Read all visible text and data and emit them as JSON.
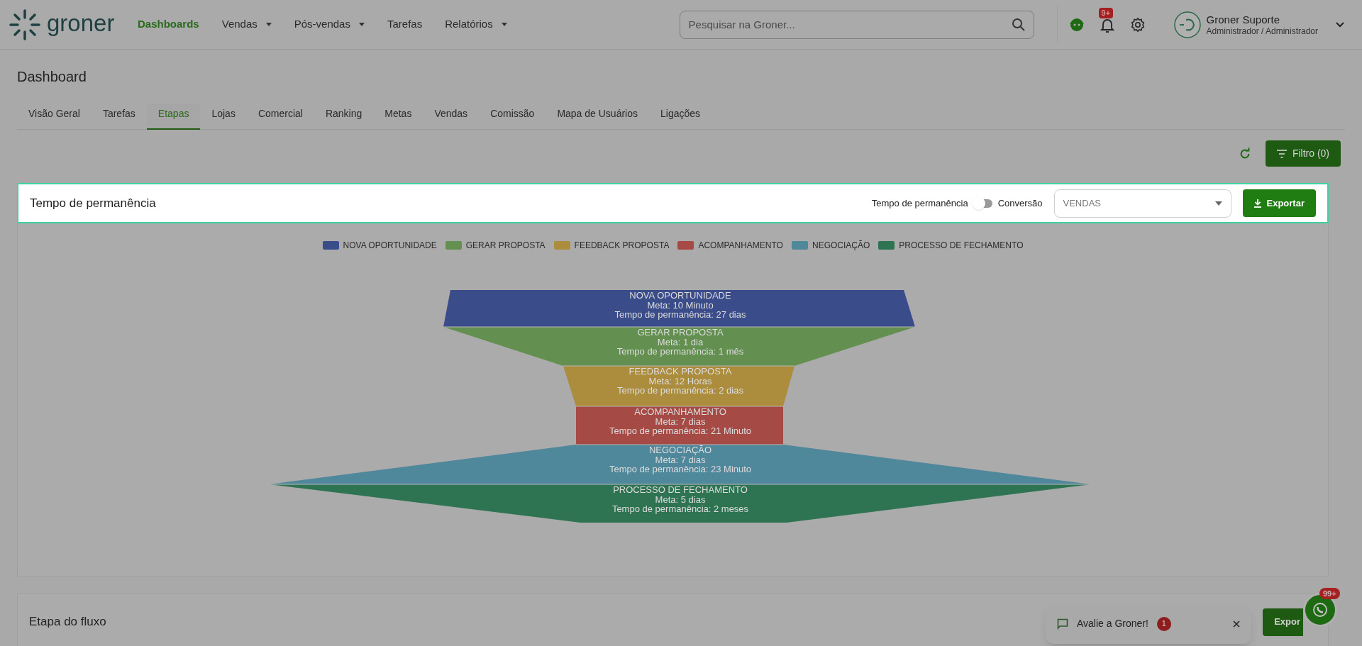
{
  "header": {
    "logo": "groner",
    "nav": [
      {
        "label": "Dashboards",
        "selected": true,
        "dropdown": false
      },
      {
        "label": "Vendas",
        "selected": false,
        "dropdown": true
      },
      {
        "label": "Pós-vendas",
        "selected": false,
        "dropdown": true
      },
      {
        "label": "Tarefas",
        "selected": false,
        "dropdown": false
      },
      {
        "label": "Relatórios",
        "selected": false,
        "dropdown": true
      }
    ],
    "search": {
      "placeholder": "Pesquisar na Groner..."
    },
    "notifications_badge": "9+",
    "user": {
      "name": "Groner Suporte",
      "role": "Administrador / Administrador"
    }
  },
  "page": {
    "title": "Dashboard",
    "tabs": [
      {
        "label": "Visão Geral",
        "selected": false
      },
      {
        "label": "Tarefas",
        "selected": false
      },
      {
        "label": "Etapas",
        "selected": true
      },
      {
        "label": "Lojas",
        "selected": false
      },
      {
        "label": "Comercial",
        "selected": false
      },
      {
        "label": "Ranking",
        "selected": false
      },
      {
        "label": "Metas",
        "selected": false
      },
      {
        "label": "Vendas",
        "selected": false
      },
      {
        "label": "Comissão",
        "selected": false
      },
      {
        "label": "Mapa de Usuários",
        "selected": false
      },
      {
        "label": "Ligações",
        "selected": false
      }
    ],
    "filter_button": "Filtro (0)"
  },
  "stay_card": {
    "title": "Tempo de permanência",
    "switch": {
      "left_label": "Tempo de permanência",
      "right_label": "Conversão",
      "on": false
    },
    "select": {
      "value": "VENDAS"
    },
    "export_button": "Exportar",
    "legend": [
      {
        "label": "NOVA OPORTUNIDADE",
        "color": "#3a4c8a"
      },
      {
        "label": "GERAR PROPOSTA",
        "color": "#638f50"
      },
      {
        "label": "FEEDBACK PROPOSTA",
        "color": "#ac8c3d"
      },
      {
        "label": "ACOMPANHAMENTO",
        "color": "#a54a45"
      },
      {
        "label": "NEGOCIAÇÃO",
        "color": "#4f879b"
      },
      {
        "label": "PROCESSO DE FECHAMENTO",
        "color": "#2e7452"
      }
    ],
    "funnel": [
      {
        "name": "NOVA OPORTUNIDADE",
        "goal": "Meta: 10 Minuto",
        "duration": "Tempo de permanência: 27 dias",
        "color": "#3a4c8a"
      },
      {
        "name": "GERAR PROPOSTA",
        "goal": "Meta: 1 dia",
        "duration": "Tempo de permanência: 1 mês",
        "color": "#638f50"
      },
      {
        "name": "FEEDBACK PROPOSTA",
        "goal": "Meta: 12 Horas",
        "duration": "Tempo de permanência: 2 dias",
        "color": "#ac8c3d"
      },
      {
        "name": "ACOMPANHAMENTO",
        "goal": "Meta: 7 dias",
        "duration": "Tempo de permanência: 21 Minuto",
        "color": "#a54a45"
      },
      {
        "name": "NEGOCIAÇÃO",
        "goal": "Meta: 7 dias",
        "duration": "Tempo de permanência: 23 Minuto",
        "color": "#4f879b"
      },
      {
        "name": "PROCESSO DE FECHAMENTO",
        "goal": "Meta: 5 dias",
        "duration": "Tempo de permanência: 2 meses",
        "color": "#2e7452"
      }
    ]
  },
  "flow_card": {
    "title": "Etapa do fluxo",
    "export_button": "Expor"
  },
  "toast": {
    "text": "Avalie a Groner!",
    "badge": "1"
  },
  "whatsapp": {
    "badge": "99+"
  }
}
